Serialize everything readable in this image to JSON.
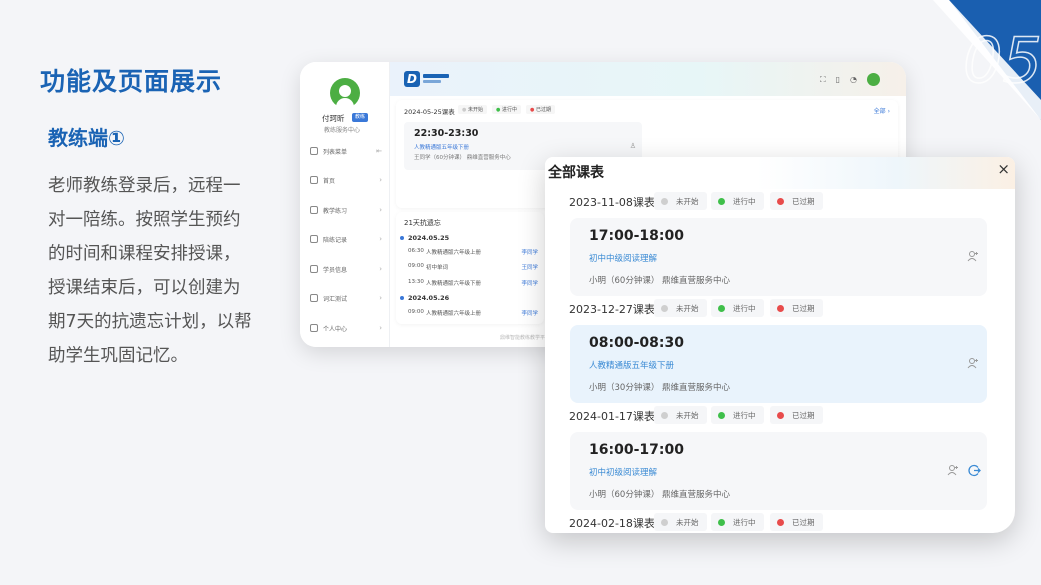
{
  "slide": {
    "title": "功能及页面展示",
    "subtitle": "教练端①",
    "paragraph": "老师教练登录后，远程一对一陪练。按照学生预约的时间和课程安排授课，授课结束后，可以创建为期7天的抗遗忘计划，以帮助学生巩固记忆。",
    "accent_color": "#1a63b4"
  },
  "back_screen": {
    "user_name": "付珂昕",
    "user_tag": "教练",
    "org": "教练服务中心",
    "menu": [
      {
        "label": "列表菜单",
        "icon": "menu-icon"
      },
      {
        "label": "首页",
        "icon": "home-icon"
      },
      {
        "label": "教学练习",
        "icon": "practice-icon"
      },
      {
        "label": "陪练记录",
        "icon": "record-icon"
      },
      {
        "label": "学员信息",
        "icon": "student-icon"
      },
      {
        "label": "词汇测试",
        "icon": "test-icon"
      },
      {
        "label": "个人中心",
        "icon": "user-icon"
      }
    ],
    "today": {
      "date": "2024-05-25课表",
      "legend": [
        "未开始",
        "进行中",
        "已过期"
      ],
      "more": "全部",
      "lesson_time": "22:30-23:30",
      "lesson_course": "人教精通版五年级下册",
      "lesson_info": "王同学（60分钟课） 鼎维直营服务中心"
    },
    "plan": {
      "title": "21天抗遗忘",
      "days": [
        {
          "date": "2024.05.25",
          "rows": [
            {
              "time": "06:30",
              "course": "人教精通版六年级上册",
              "student": "李同学"
            },
            {
              "time": "09:00",
              "course": "初中单词",
              "student": "王同学"
            },
            {
              "time": "13:30",
              "course": "人教精通版六年级下册",
              "student": "李同学"
            }
          ]
        },
        {
          "date": "2024.05.26",
          "rows": [
            {
              "time": "09:00",
              "course": "人教精通版六年级上册",
              "student": "李同学"
            }
          ]
        }
      ]
    },
    "footer": "鼎维智能教练教学平台"
  },
  "modal": {
    "title": "全部课表",
    "close_label": "×",
    "legend": {
      "not_started": "未开始",
      "in_progress": "进行中",
      "expired": "已过期"
    },
    "status_colors": {
      "not_started": "#cfcfcf",
      "in_progress": "#3fbf4a",
      "expired": "#e84b4b"
    },
    "days": [
      {
        "date": "2023-11-08课表",
        "time": "17:00-18:00",
        "course": "初中中级阅读理解",
        "info": "小明（60分钟课） 鼎维直营服务中心"
      },
      {
        "date": "2023-12-27课表",
        "time": "08:00-08:30",
        "course": "人教精通版五年级下册",
        "info": "小明（30分钟课） 鼎维直营服务中心"
      },
      {
        "date": "2024-01-17课表",
        "time": "16:00-17:00",
        "course": "初中初级阅读理解",
        "info": "小明（60分钟课） 鼎维直营服务中心"
      },
      {
        "date": "2024-02-18课表"
      }
    ]
  }
}
